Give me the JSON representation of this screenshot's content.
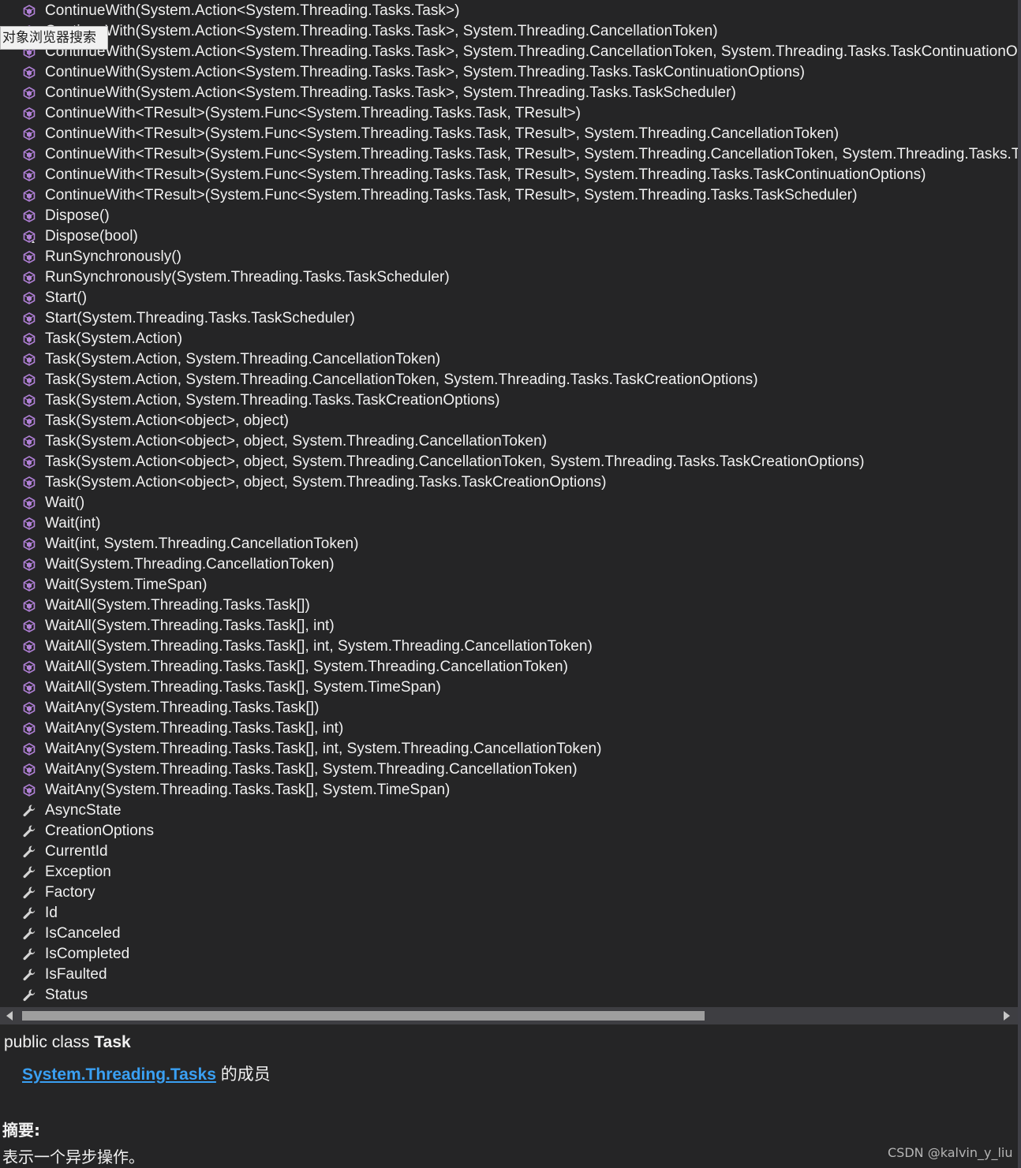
{
  "tooltip": "对象浏览器搜索",
  "members": [
    {
      "icon": "method-icon",
      "label": "ContinueWith(System.Action<System.Threading.Tasks.Task>)"
    },
    {
      "icon": "method-icon",
      "label": "ContinueWith(System.Action<System.Threading.Tasks.Task>, System.Threading.CancellationToken)"
    },
    {
      "icon": "method-icon",
      "label": "ContinueWith(System.Action<System.Threading.Tasks.Task>, System.Threading.CancellationToken, System.Threading.Tasks.TaskContinuationOp"
    },
    {
      "icon": "method-icon",
      "label": "ContinueWith(System.Action<System.Threading.Tasks.Task>, System.Threading.Tasks.TaskContinuationOptions)"
    },
    {
      "icon": "method-icon",
      "label": "ContinueWith(System.Action<System.Threading.Tasks.Task>, System.Threading.Tasks.TaskScheduler)"
    },
    {
      "icon": "method-icon",
      "label": "ContinueWith<TResult>(System.Func<System.Threading.Tasks.Task, TResult>)"
    },
    {
      "icon": "method-icon",
      "label": "ContinueWith<TResult>(System.Func<System.Threading.Tasks.Task, TResult>, System.Threading.CancellationToken)"
    },
    {
      "icon": "method-icon",
      "label": "ContinueWith<TResult>(System.Func<System.Threading.Tasks.Task, TResult>, System.Threading.CancellationToken, System.Threading.Tasks.Tas"
    },
    {
      "icon": "method-icon",
      "label": "ContinueWith<TResult>(System.Func<System.Threading.Tasks.Task, TResult>, System.Threading.Tasks.TaskContinuationOptions)"
    },
    {
      "icon": "method-icon",
      "label": "ContinueWith<TResult>(System.Func<System.Threading.Tasks.Task, TResult>, System.Threading.Tasks.TaskScheduler)"
    },
    {
      "icon": "method-icon",
      "label": "Dispose()"
    },
    {
      "icon": "protected-method-icon",
      "label": "Dispose(bool)"
    },
    {
      "icon": "method-icon",
      "label": "RunSynchronously()"
    },
    {
      "icon": "method-icon",
      "label": "RunSynchronously(System.Threading.Tasks.TaskScheduler)"
    },
    {
      "icon": "method-icon",
      "label": "Start()"
    },
    {
      "icon": "method-icon",
      "label": "Start(System.Threading.Tasks.TaskScheduler)"
    },
    {
      "icon": "method-icon",
      "label": "Task(System.Action)"
    },
    {
      "icon": "method-icon",
      "label": "Task(System.Action, System.Threading.CancellationToken)"
    },
    {
      "icon": "method-icon",
      "label": "Task(System.Action, System.Threading.CancellationToken, System.Threading.Tasks.TaskCreationOptions)"
    },
    {
      "icon": "method-icon",
      "label": "Task(System.Action, System.Threading.Tasks.TaskCreationOptions)"
    },
    {
      "icon": "method-icon",
      "label": "Task(System.Action<object>, object)"
    },
    {
      "icon": "method-icon",
      "label": "Task(System.Action<object>, object, System.Threading.CancellationToken)"
    },
    {
      "icon": "method-icon",
      "label": "Task(System.Action<object>, object, System.Threading.CancellationToken, System.Threading.Tasks.TaskCreationOptions)"
    },
    {
      "icon": "method-icon",
      "label": "Task(System.Action<object>, object, System.Threading.Tasks.TaskCreationOptions)"
    },
    {
      "icon": "method-icon",
      "label": "Wait()"
    },
    {
      "icon": "method-icon",
      "label": "Wait(int)"
    },
    {
      "icon": "method-icon",
      "label": "Wait(int, System.Threading.CancellationToken)"
    },
    {
      "icon": "method-icon",
      "label": "Wait(System.Threading.CancellationToken)"
    },
    {
      "icon": "method-icon",
      "label": "Wait(System.TimeSpan)"
    },
    {
      "icon": "method-icon",
      "label": "WaitAll(System.Threading.Tasks.Task[])"
    },
    {
      "icon": "method-icon",
      "label": "WaitAll(System.Threading.Tasks.Task[], int)"
    },
    {
      "icon": "method-icon",
      "label": "WaitAll(System.Threading.Tasks.Task[], int, System.Threading.CancellationToken)"
    },
    {
      "icon": "method-icon",
      "label": "WaitAll(System.Threading.Tasks.Task[], System.Threading.CancellationToken)"
    },
    {
      "icon": "method-icon",
      "label": "WaitAll(System.Threading.Tasks.Task[], System.TimeSpan)"
    },
    {
      "icon": "method-icon",
      "label": "WaitAny(System.Threading.Tasks.Task[])"
    },
    {
      "icon": "method-icon",
      "label": "WaitAny(System.Threading.Tasks.Task[], int)"
    },
    {
      "icon": "method-icon",
      "label": "WaitAny(System.Threading.Tasks.Task[], int, System.Threading.CancellationToken)"
    },
    {
      "icon": "method-icon",
      "label": "WaitAny(System.Threading.Tasks.Task[], System.Threading.CancellationToken)"
    },
    {
      "icon": "method-icon",
      "label": "WaitAny(System.Threading.Tasks.Task[], System.TimeSpan)"
    },
    {
      "icon": "property-icon",
      "label": "AsyncState"
    },
    {
      "icon": "property-icon",
      "label": "CreationOptions"
    },
    {
      "icon": "property-icon",
      "label": "CurrentId"
    },
    {
      "icon": "property-icon",
      "label": "Exception"
    },
    {
      "icon": "property-icon",
      "label": "Factory"
    },
    {
      "icon": "property-icon",
      "label": "Id"
    },
    {
      "icon": "property-icon",
      "label": "IsCanceled"
    },
    {
      "icon": "property-icon",
      "label": "IsCompleted"
    },
    {
      "icon": "property-icon",
      "label": "IsFaulted"
    },
    {
      "icon": "property-icon",
      "label": "Status"
    }
  ],
  "description": {
    "declaration_prefix": "public class ",
    "class_name": "Task",
    "namespace_link": "System.Threading.Tasks",
    "member_of_suffix": " 的成员",
    "summary_heading": "摘要:",
    "summary_text": "表示一个异步操作。"
  },
  "watermark": "CSDN @kalvin_y_liu",
  "colors": {
    "background": "#252526",
    "method_icon": "#b180d7",
    "property_icon": "#d4d4d4",
    "link": "#3aa0f3"
  }
}
